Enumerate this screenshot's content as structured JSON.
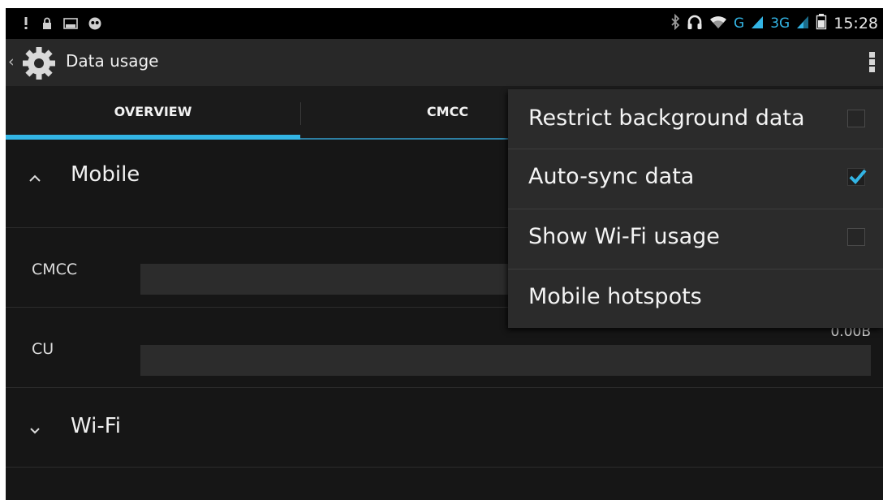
{
  "status_bar": {
    "left_icons": [
      "alert-icon",
      "lock-icon",
      "image-notification-icon",
      "android-alien-icon"
    ],
    "right_icons": [
      "bluetooth-icon",
      "headset-icon",
      "wifi-icon",
      "signal-icon",
      "battery-icon"
    ],
    "network_1": "G",
    "network_2": "3G",
    "time": "15:28"
  },
  "action_bar": {
    "title": "Data usage",
    "app_icon": "gear-icon",
    "overflow_icon": "overflow-menu-icon"
  },
  "tabs": [
    {
      "label": "OVERVIEW",
      "selected": true
    },
    {
      "label": "CMCC",
      "selected": false
    }
  ],
  "sections": {
    "mobile": {
      "title": "Mobile",
      "expanded": true
    },
    "wifi": {
      "title": "Wi-Fi",
      "expanded": false
    }
  },
  "usage_rows": [
    {
      "label": "CMCC",
      "amount": "",
      "fraction": 0
    },
    {
      "label": "CU",
      "amount": "0.00B",
      "fraction": 0
    }
  ],
  "menu": {
    "items": [
      {
        "label": "Restrict background data",
        "has_checkbox": true,
        "checked": false
      },
      {
        "label": "Auto-sync data",
        "has_checkbox": true,
        "checked": true
      },
      {
        "label": "Show Wi-Fi usage",
        "has_checkbox": true,
        "checked": false
      },
      {
        "label": "Mobile hotspots",
        "has_checkbox": false,
        "checked": false
      }
    ]
  },
  "colors": {
    "accent": "#33b5e5",
    "background": "#161616",
    "menu_background": "#2b2b2b"
  }
}
